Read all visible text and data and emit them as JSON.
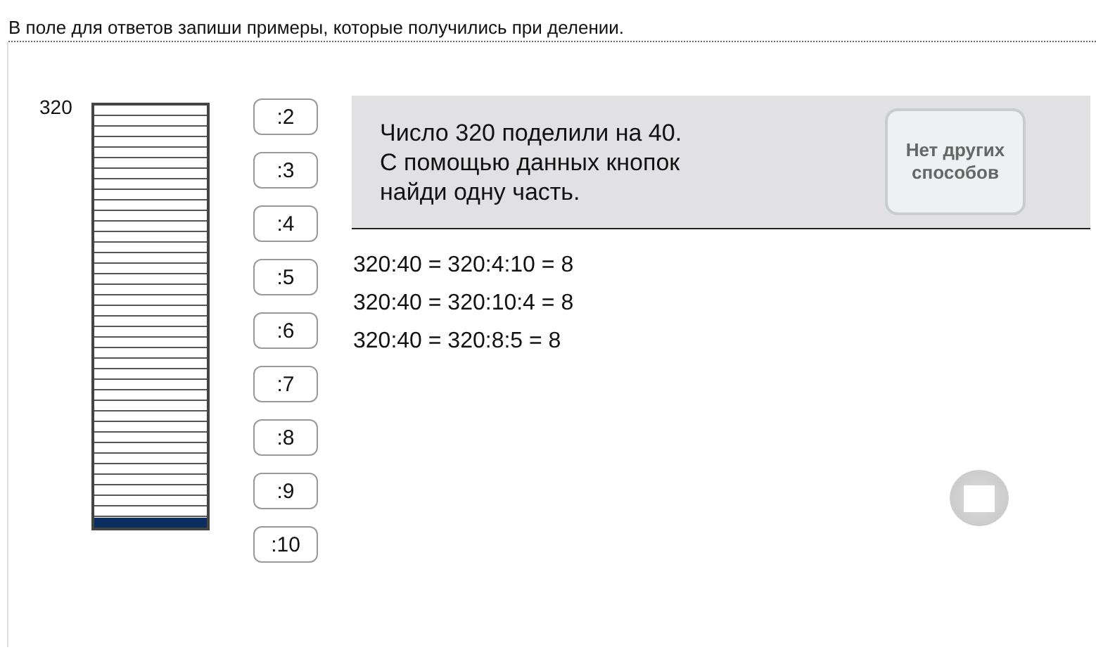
{
  "instruction": "В поле для ответов запиши примеры, которые получились при делении.",
  "bar": {
    "label": "320",
    "level": 0.025
  },
  "divisor_buttons": [
    ":2",
    ":3",
    ":4",
    ":5",
    ":6",
    ":7",
    ":8",
    ":9",
    ":10"
  ],
  "task": {
    "lines": [
      "Число 320 поделили на 40.",
      "С помощью данных кнопок",
      "найди одну часть."
    ],
    "button": "Нет других способов"
  },
  "answers": [
    "320:40 = 320:4:10 = 8",
    "320:40 = 320:10:4 = 8",
    "320:40 = 320:8:5 = 8"
  ]
}
